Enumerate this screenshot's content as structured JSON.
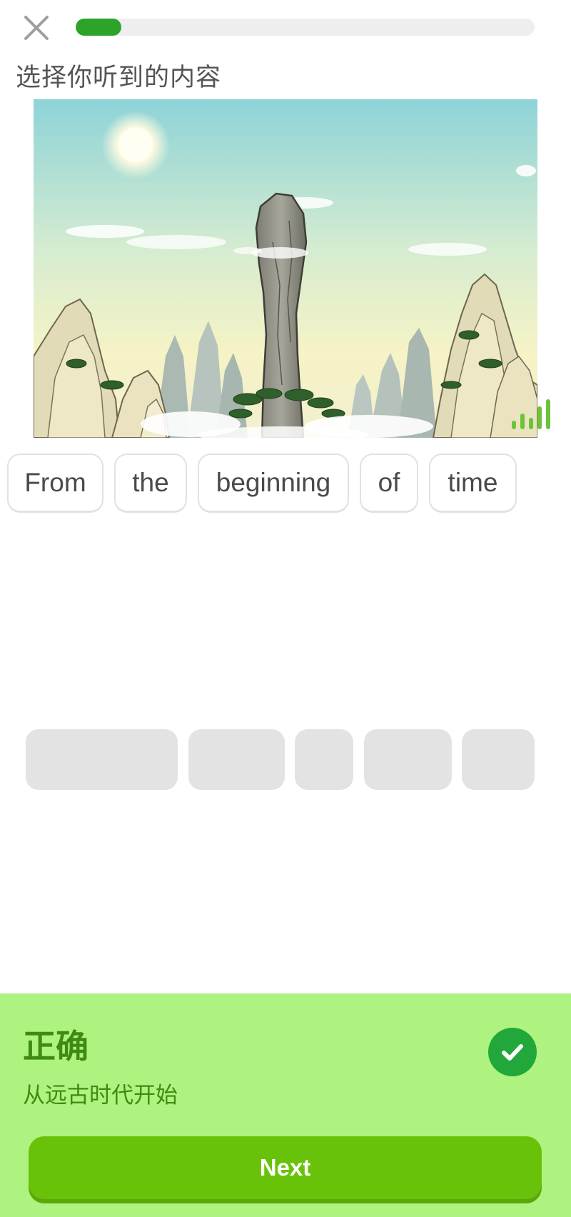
{
  "header": {
    "close_icon": "close-icon",
    "progress_fraction": 0.1
  },
  "prompt": {
    "instruction": "选择你听到的内容"
  },
  "illustration": {
    "subject": "cartoon-landscape-stone-pillar",
    "audio_icon": "audio-waveform-icon"
  },
  "word_bank": {
    "words": [
      "From",
      "the",
      "beginning",
      "of",
      "time"
    ]
  },
  "answer_area": {
    "slot_count": 5
  },
  "feedback": {
    "title": "正确",
    "translation": "从远古时代开始",
    "status_icon": "check-icon",
    "next_label": "Next"
  },
  "colors": {
    "progress": "#2ea32a",
    "feedback_bg": "#aef37f",
    "feedback_text": "#3f8a13",
    "next_button": "#69c20a",
    "check_badge": "#22a83a"
  }
}
